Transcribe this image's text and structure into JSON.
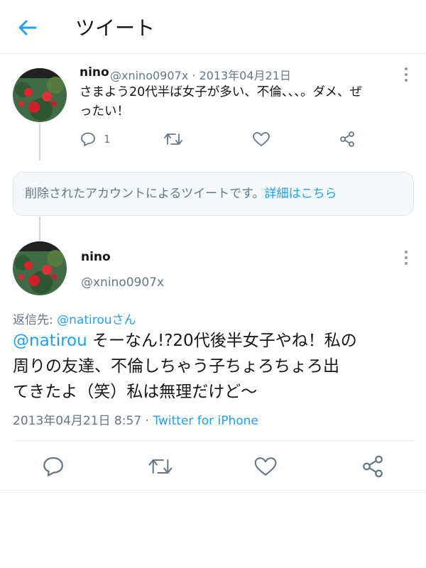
{
  "header": {
    "title": "ツイート",
    "back_icon": "arrow-left-icon"
  },
  "colors": {
    "accent": "#1da1f2",
    "muted": "#657786",
    "text": "#14171a",
    "border": "#e6ecf0"
  },
  "parent_tweet": {
    "name": "nino",
    "handle": "@xnino0907x",
    "separator": "·",
    "date": "2013年04月21日",
    "text_line1": "さまよう20代半ば女子が多い、不倫、、、。ダメ、ぜ",
    "text_line2": "ったい！",
    "reply_count": "1",
    "icons": [
      "reply-icon",
      "retweet-icon",
      "like-icon",
      "share-icon"
    ]
  },
  "deleted_notice": {
    "text": "削除されたアカウントによるツイートです。",
    "link": "詳細はこちら"
  },
  "main_tweet": {
    "name": "nino",
    "handle": "@xnino0907x",
    "reply_label": "返信先: ",
    "reply_to": "@natirou",
    "reply_suffix": "さん",
    "mention": "@natirou",
    "text_line1_rest": " そーなん!?20代後半女子やね！私の",
    "text_line2": "周りの友達、不倫しちゃう子ちょろちょろ出",
    "text_line3": "てきたよ（笑）私は無理だけど〜",
    "timestamp": "2013年04月21日 8:57",
    "separator": " · ",
    "source": "Twitter for iPhone",
    "icons": [
      "reply-icon",
      "retweet-icon",
      "like-icon",
      "share-icon"
    ]
  }
}
